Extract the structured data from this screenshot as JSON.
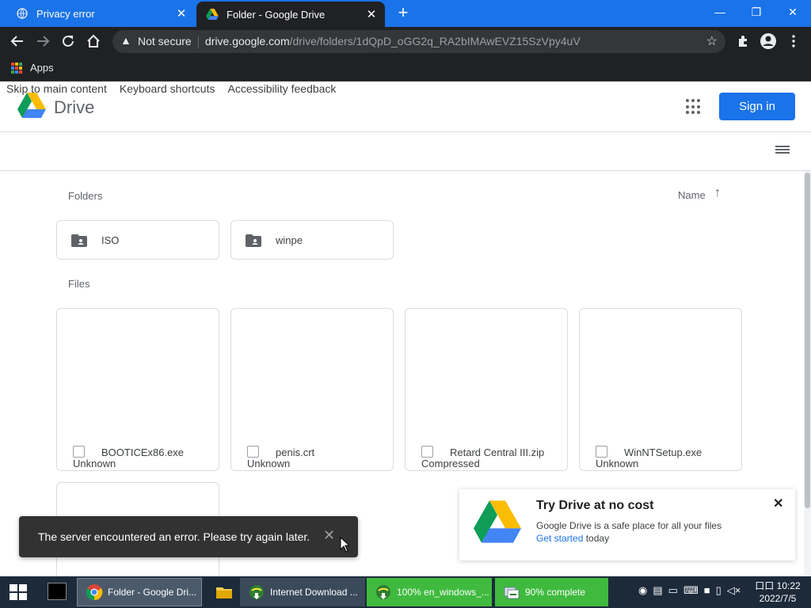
{
  "browser": {
    "tabs": [
      {
        "title": "Privacy error",
        "close": "✕"
      },
      {
        "title": "Folder - Google Drive",
        "close": "✕"
      }
    ],
    "new_tab": "+",
    "window_controls": {
      "minimize": "—",
      "restore": "❐",
      "close": "✕"
    },
    "address": {
      "security_icon": "warning-icon",
      "security_label": "Not secure",
      "host": "drive.google.com",
      "path": "/drive/folders/1dQpD_oGG2q_RA2bIMAwEVZ15SzVpy4uV"
    },
    "bookmarks": {
      "apps_label": "Apps"
    }
  },
  "page": {
    "skip_links": [
      "Skip to main content",
      "Keyboard shortcuts",
      "Accessibility feedback"
    ],
    "logo_text": "Drive",
    "sign_in": "Sign in",
    "folders_heading": "Folders",
    "files_heading": "Files",
    "sort_label": "Name",
    "sort_arrow": "↑",
    "folders": [
      {
        "name": "ISO"
      },
      {
        "name": "winpe"
      }
    ],
    "files": [
      {
        "name": "BOOTICEx86.exe",
        "type": "Unknown"
      },
      {
        "name": "penis.crt",
        "type": "Unknown"
      },
      {
        "name": "Retard Central III.zip",
        "type": "Compressed"
      },
      {
        "name": "WinNTSetup.exe",
        "type": "Unknown"
      }
    ],
    "snackbar": {
      "message": "The server encountered an error. Please try again later.",
      "close": "✕"
    },
    "promo": {
      "title": "Try Drive at no cost",
      "text": "Google Drive is a safe place for all your files",
      "link": "Get started",
      "suffix": " today",
      "close": "✕"
    }
  },
  "taskbar": {
    "items": [
      {
        "label": "Folder - Google Dri..."
      },
      {
        "label": "Internet Download ..."
      },
      {
        "label": "100% en_windows_..."
      },
      {
        "label": "90% complete"
      }
    ],
    "clock": {
      "time": "10:22",
      "date": "2022/7/5",
      "ime": "口口"
    }
  },
  "colors": {
    "accent": "#1a73e8",
    "chrome_dark": "#202124",
    "taskbar": "#1c2a3a",
    "progress_green": "#3fba3f"
  }
}
